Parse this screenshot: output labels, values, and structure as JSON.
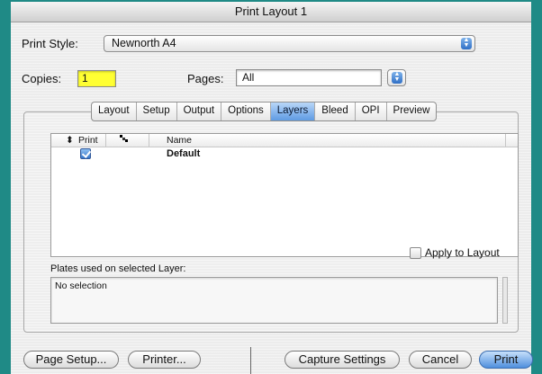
{
  "window": {
    "title": "Print Layout 1"
  },
  "print_style": {
    "label": "Print Style:",
    "value": "Newnorth A4"
  },
  "copies": {
    "label": "Copies:",
    "value": "1"
  },
  "pages": {
    "label": "Pages:",
    "value": "All"
  },
  "tabs": [
    {
      "label": "Layout",
      "active": false
    },
    {
      "label": "Setup",
      "active": false
    },
    {
      "label": "Output",
      "active": false
    },
    {
      "label": "Options",
      "active": false
    },
    {
      "label": "Layers",
      "active": true
    },
    {
      "label": "Bleed",
      "active": false
    },
    {
      "label": "OPI",
      "active": false
    },
    {
      "label": "Preview",
      "active": false
    }
  ],
  "layers_table": {
    "columns": {
      "print": "Print",
      "name": "Name"
    },
    "rows": [
      {
        "print": true,
        "name": "Default"
      }
    ]
  },
  "apply_to_layout": {
    "label": "Apply to Layout",
    "checked": false
  },
  "plates": {
    "label": "Plates used on selected Layer:",
    "value": "No selection"
  },
  "buttons": {
    "page_setup": "Page Setup...",
    "printer": "Printer...",
    "capture_settings": "Capture Settings",
    "cancel": "Cancel",
    "print": "Print"
  },
  "colors": {
    "background": "#1f8a86",
    "copies_highlight": "#ffff33",
    "accent": "#4f8fdd"
  }
}
